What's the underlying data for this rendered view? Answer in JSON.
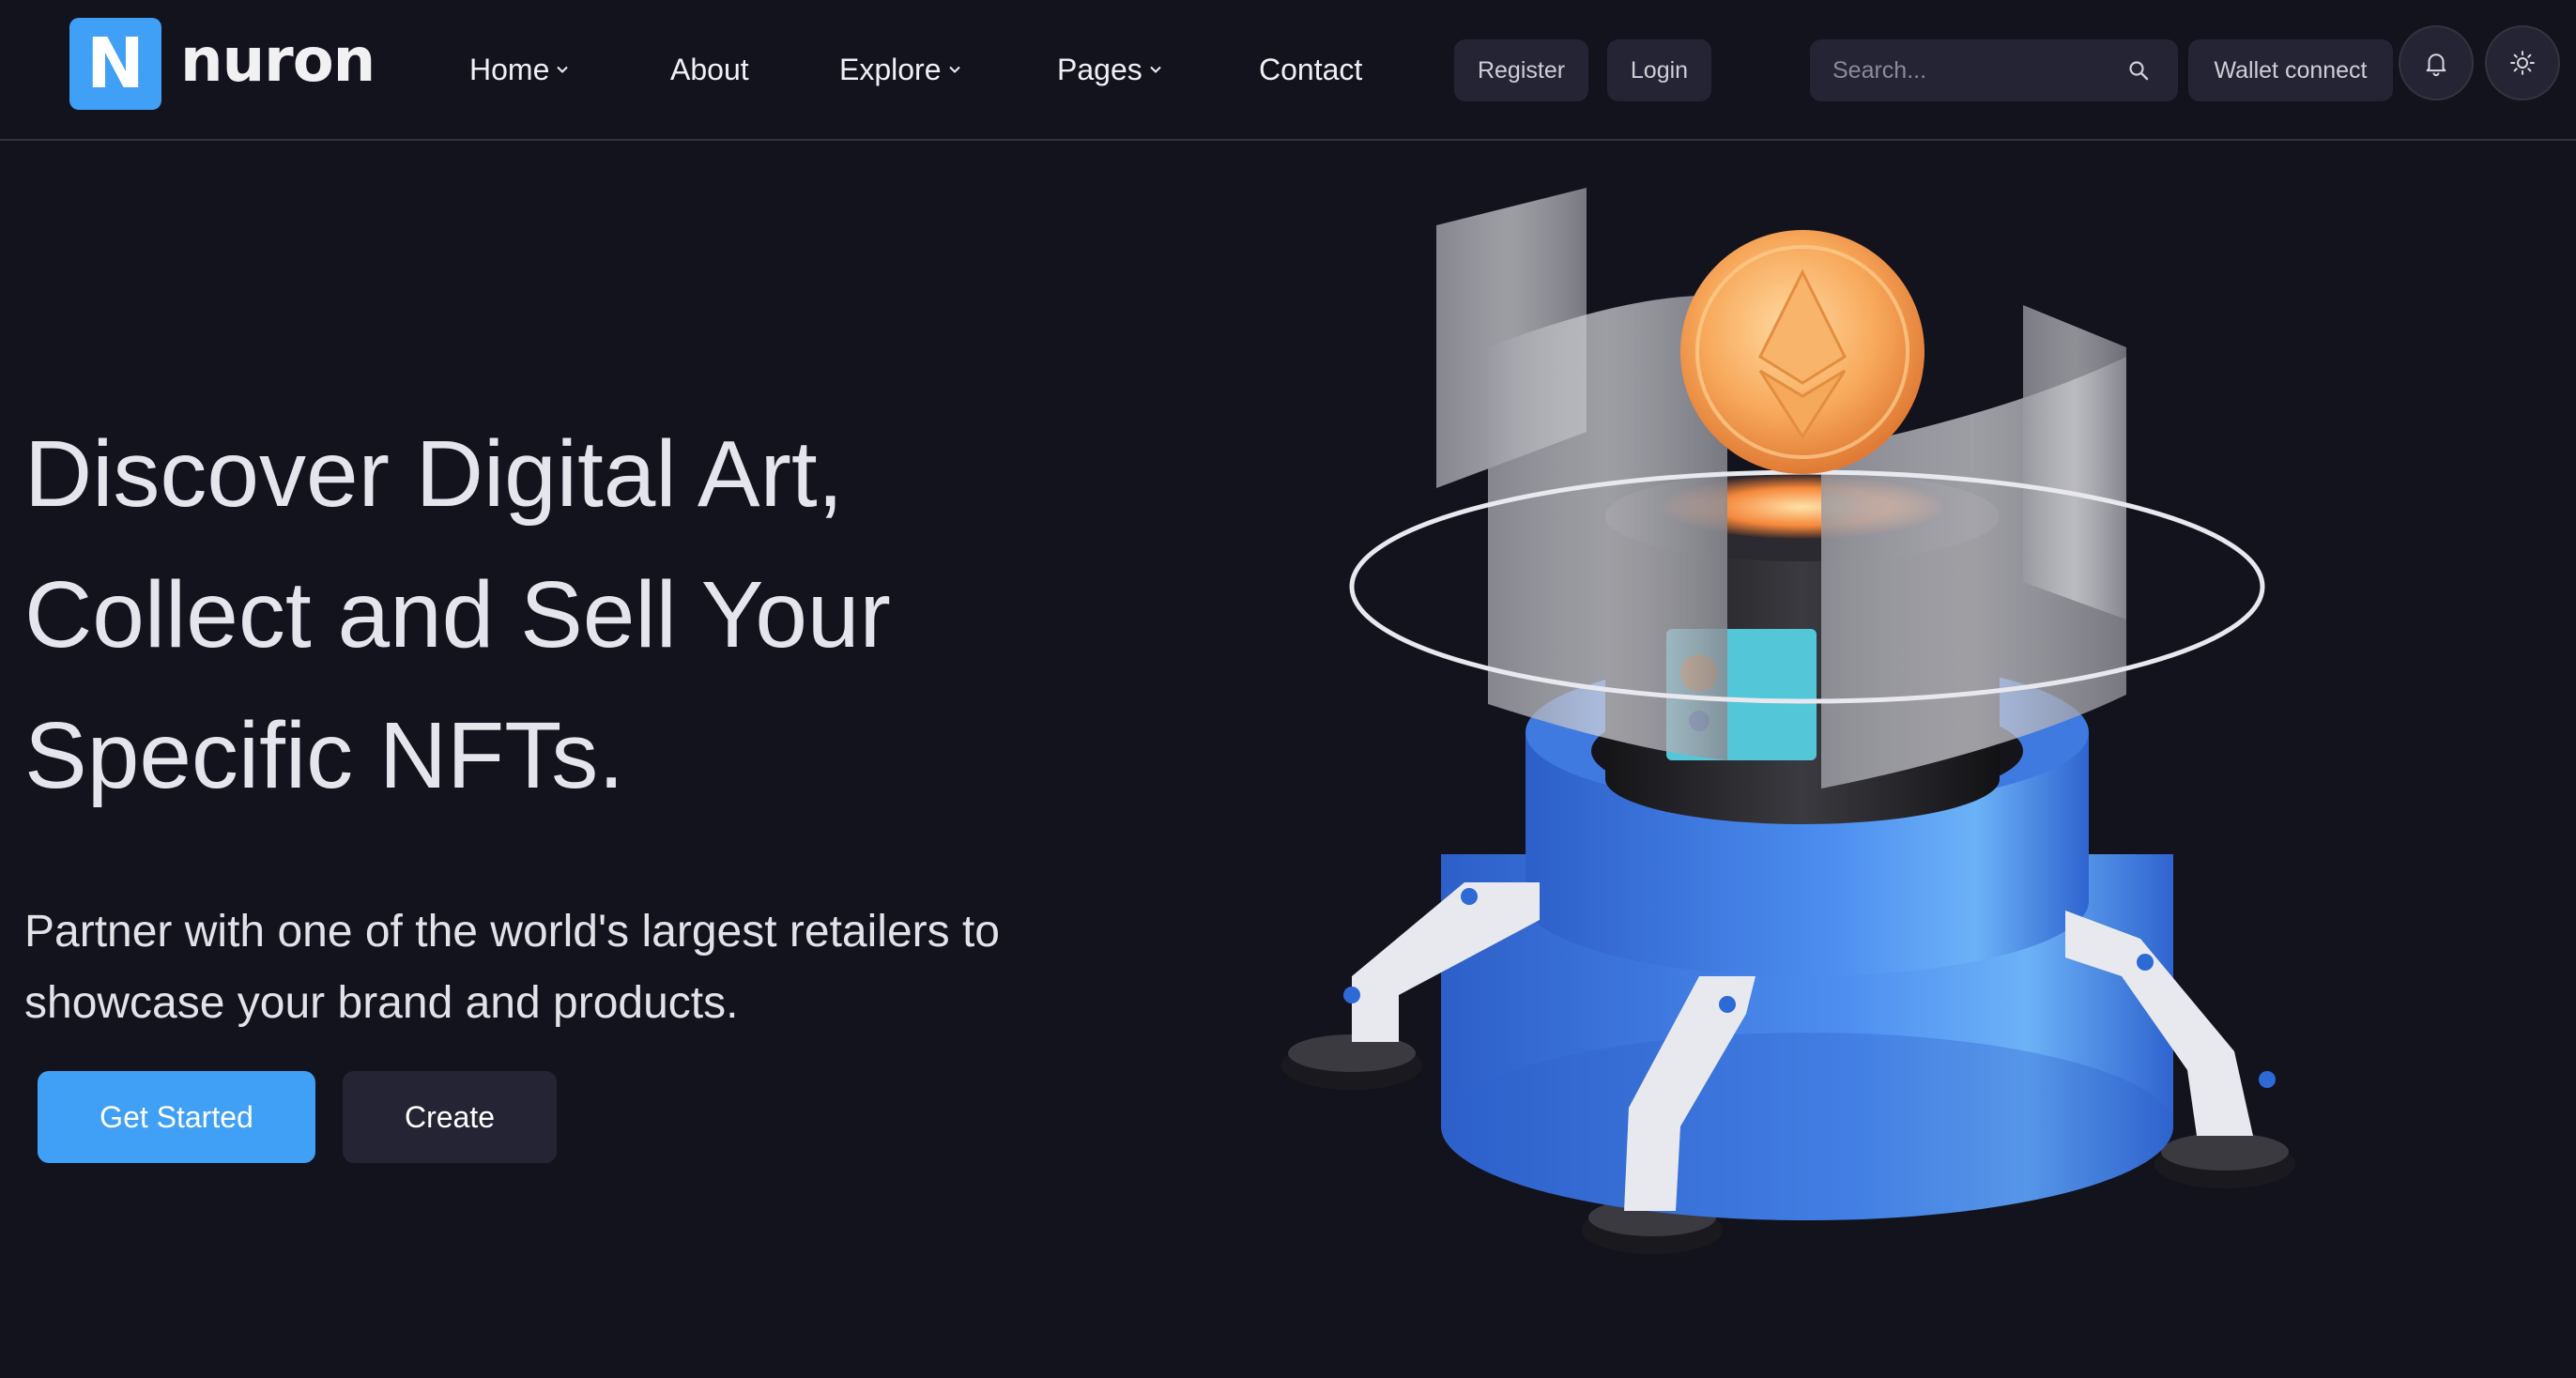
{
  "brand": {
    "logo_letter": "N",
    "name": "nuron",
    "accent": "#3fa0f6"
  },
  "nav": [
    {
      "label": "Home",
      "has_dropdown": true
    },
    {
      "label": "About",
      "has_dropdown": false
    },
    {
      "label": "Explore",
      "has_dropdown": true
    },
    {
      "label": "Pages",
      "has_dropdown": true
    },
    {
      "label": "Contact",
      "has_dropdown": false
    }
  ],
  "header_actions": {
    "register_label": "Register",
    "login_label": "Login",
    "search_placeholder": "Search...",
    "wallet_label": "Wallet connect",
    "icons": [
      "search-icon",
      "bell-icon",
      "sun-icon"
    ]
  },
  "hero": {
    "title": "Discover Digital Art,\nCollect and Sell Your\nSpecific NFTs.",
    "subtitle": "Partner with one of the world's largest retailers to showcase your brand and products.",
    "primary_cta": "Get Started",
    "secondary_cta": "Create"
  },
  "colors": {
    "background": "#13131d",
    "surface": "#242434",
    "accent": "#3fa0f6"
  }
}
